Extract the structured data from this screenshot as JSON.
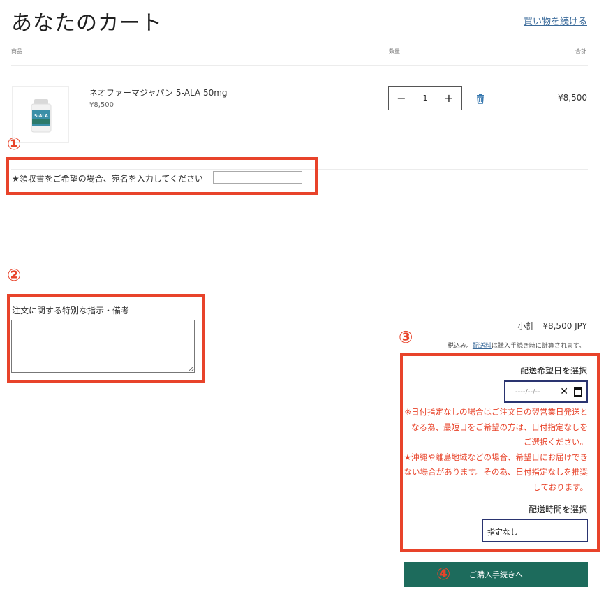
{
  "header": {
    "title": "あなたのカート",
    "continue_link": "買い物を続ける"
  },
  "table": {
    "col_product": "商品",
    "col_quantity": "数量",
    "col_total": "合計"
  },
  "cart_item": {
    "name": "ネオファーマジャパン 5-ALA 50mg",
    "unit_price": "¥8,500",
    "quantity": "1",
    "decrement_symbol": "−",
    "increment_symbol": "+",
    "line_total": "¥8,500",
    "thumbnail_text": "5-ALA"
  },
  "annotations": {
    "one": "①",
    "two": "②",
    "three": "③",
    "four": "④"
  },
  "receipt": {
    "label": "★領収書をご希望の場合、宛名を入力してください",
    "value": ""
  },
  "notes": {
    "label": "注文に関する特別な指示・備考",
    "value": ""
  },
  "summary": {
    "subtotal_label": "小計",
    "subtotal_value": "¥8,500 JPY",
    "tax_prefix": "税込み。",
    "shipping_link": "配送料",
    "tax_suffix": "は購入手続き時に計算されます。"
  },
  "delivery": {
    "date_label": "配送希望日を選択",
    "date_placeholder": "----/--/--",
    "clear_symbol": "✕",
    "notice_1": "※日付指定なしの場合はご注文日の翌営業日発送となる為、最短日をご希望の方は、日付指定なしをご選択ください。",
    "notice_2": "★沖縄や離島地域などの場合、希望日にお届けできない場合があります。その為、日付指定なしを推奨しております。",
    "time_label": "配送時間を選択",
    "time_selected": "指定なし"
  },
  "checkout": {
    "label": "ご購入手続きへ"
  },
  "colors": {
    "annotation_red": "#e8432a",
    "checkout_green": "#1d6b5c",
    "link_blue": "#3a6a9a",
    "input_border_navy": "#2a3470"
  },
  "icons": {
    "trash": "trash-icon",
    "calendar": "calendar-icon"
  }
}
